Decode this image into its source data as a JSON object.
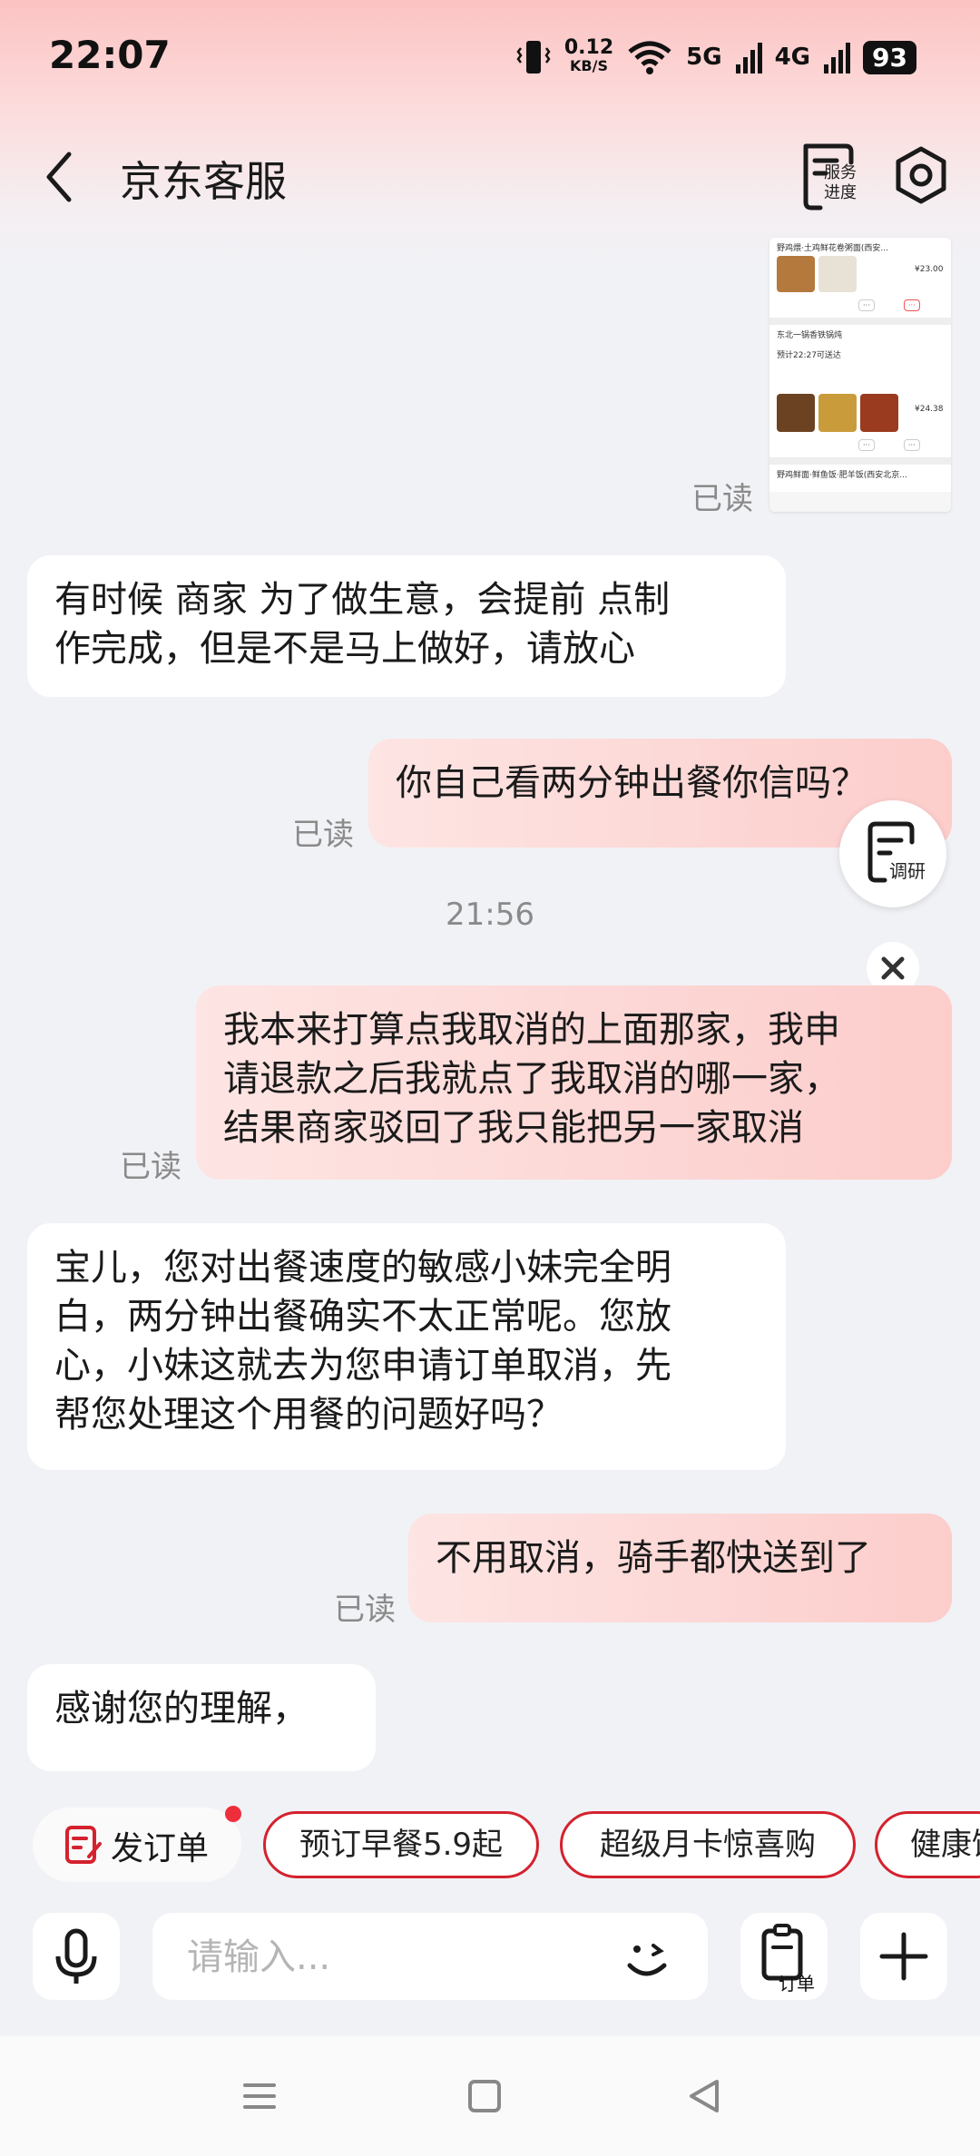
{
  "status_bar": {
    "time": "22:07",
    "net_speed": "0.12",
    "net_unit": "KB/S",
    "sig1": "5G",
    "sig2": "4G",
    "battery": "93"
  },
  "header": {
    "title": "京东客服",
    "service_progress_label": "服务进度"
  },
  "thumbnail": {
    "line1": "野鸡煨·土鸡鲜花卷粥面(西安...",
    "price1": "¥23.00",
    "line2": "东北一锅香铁锅炖",
    "line3": "预计22:27可送达",
    "price2": "¥24.38",
    "line4": "野鸡鲜面·鲜鱼饭·肥羊饭(西安北京..."
  },
  "messages": [
    {
      "side": "right",
      "read": "已读"
    },
    {
      "side": "left",
      "text_l1": "有时候 商家 为了做生意，会提前 点制",
      "text_l2": "作完成，但是不是马上做好，请放心"
    },
    {
      "side": "right",
      "text": "你自己看两分钟出餐你信吗？",
      "read": "已读"
    },
    {
      "side": "time",
      "text": "21:56"
    },
    {
      "side": "right",
      "text_l1": "我本来打算点我取消的上面那家，我申",
      "text_l2": "请退款之后我就点了我取消的哪一家，",
      "text_l3": "结果商家驳回了我只能把另一家取消",
      "read": "已读"
    },
    {
      "side": "left",
      "text_l1": "宝儿，您对出餐速度的敏感小妹完全明",
      "text_l2": "白，两分钟出餐确实不太正常呢。您放",
      "text_l3": "心，小妹这就去为您申请订单取消，先",
      "text_l4": "帮您处理这个用餐的问题好吗？"
    },
    {
      "side": "right",
      "text": "不用取消，骑手都快送到了",
      "read": "已读"
    },
    {
      "side": "left",
      "text": "感谢您的理解，"
    }
  ],
  "float_button_label": "调研",
  "chips": [
    "发订单",
    "预订早餐5.9起",
    "超级月卡惊喜购",
    "健康饮食"
  ],
  "input": {
    "placeholder": "请输入...",
    "order_label": "订单"
  },
  "colors": {
    "accent": "#d4222e",
    "bubble_right": "#fcd6d4",
    "bubble_left": "#ffffff",
    "background": "#f1f2f6"
  }
}
